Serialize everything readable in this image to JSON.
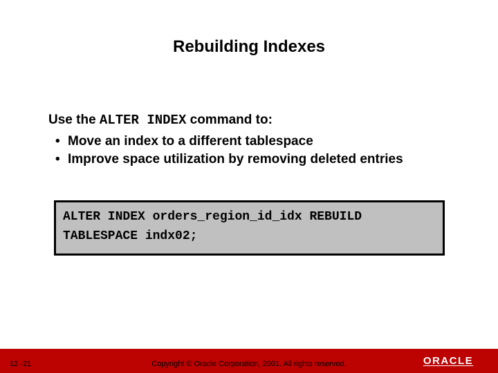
{
  "title": "Rebuilding Indexes",
  "lead": {
    "pre": "Use the ",
    "code": "ALTER INDEX",
    "post": " command to:"
  },
  "bullets": [
    "Move an index to a different tablespace",
    "Improve space utilization by removing deleted entries"
  ],
  "code": {
    "line1": "ALTER INDEX orders_region_id_idx REBUILD",
    "line2": "TABLESPACE indx02;"
  },
  "footer": {
    "page": "12 -21",
    "copyright": "Copyright © Oracle Corporation, 2001. All rights reserved.",
    "logo": "ORACLE"
  },
  "colors": {
    "footer_bg": "#bd0202",
    "codebox_bg": "#c0c0c0"
  }
}
